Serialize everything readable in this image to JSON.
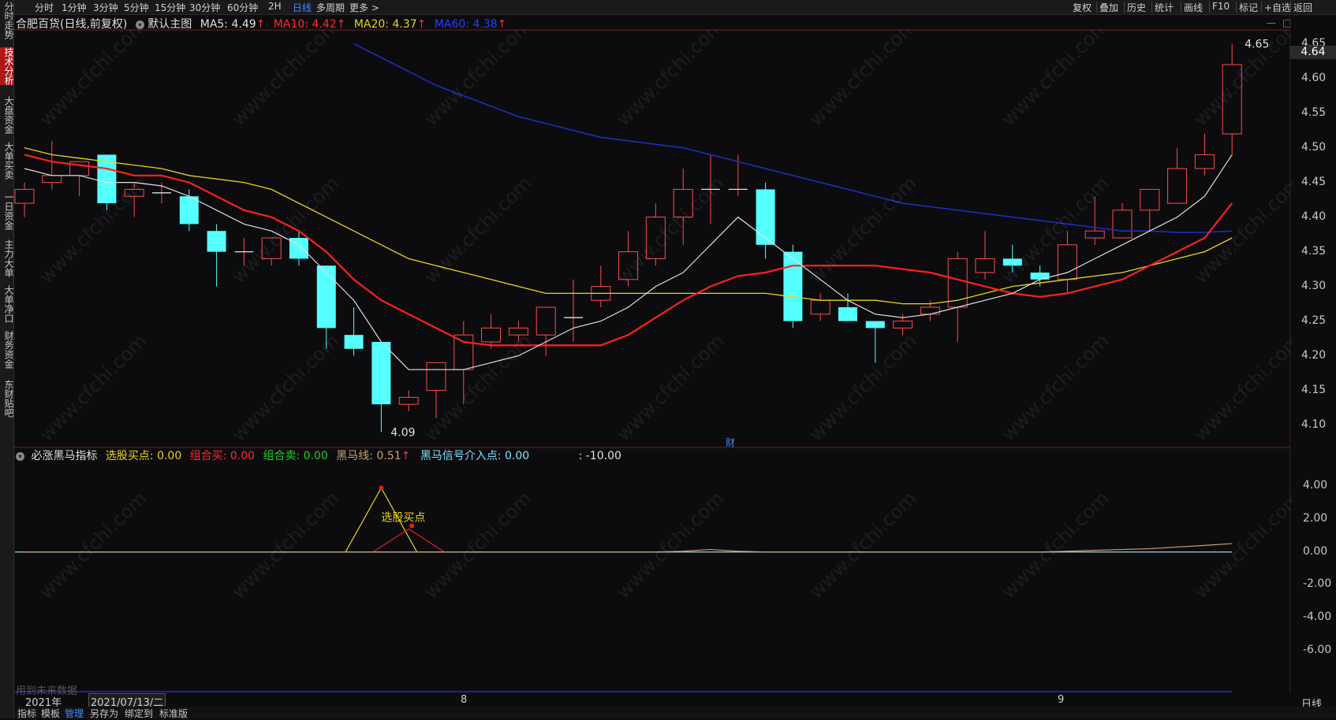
{
  "sidebar": {
    "items": [
      {
        "label": "分时走势",
        "active": false
      },
      {
        "label": "技术分析",
        "active": true
      },
      {
        "label": "大盘资金",
        "active": false
      },
      {
        "label": "大单买卖",
        "active": false
      },
      {
        "label": "一日资金",
        "active": false
      },
      {
        "label": "主力大单",
        "active": false
      },
      {
        "label": "大单净口",
        "active": false
      },
      {
        "label": "财务资金",
        "active": false
      },
      {
        "label": "东财贴吧",
        "active": false
      }
    ]
  },
  "toolbar": {
    "periods": [
      "分时",
      "1分钟",
      "3分钟",
      "5分钟",
      "15分钟",
      "30分钟",
      "60分钟",
      "2H",
      "日线",
      "多周期",
      "更多 >"
    ],
    "active_period": "日线",
    "right_items": [
      "复权",
      "叠加",
      "历史",
      "统计",
      "画线",
      "F10",
      "标记",
      "+自选",
      "返回"
    ]
  },
  "title": {
    "stock": "合肥百货(日线,前复权)",
    "template": "默认主图",
    "ma5": "MA5: 4.49",
    "ma10": "MA10: 4.42",
    "ma20": "MA20: 4.37",
    "ma60": "MA60: 4.38",
    "arrow": "↑"
  },
  "indicator": {
    "name": "必涨黑马指标",
    "buy": "选股买点: 0.00",
    "combo_buy": "组合买: 0.00",
    "combo_sell": "组合卖: 0.00",
    "horse_line": "黑马线: 0.51",
    "horse_signal": "黑马信号介入点: 0.00",
    "extra": ": -10.00",
    "annotation": "选股买点"
  },
  "window_controls": [
    "—",
    "□"
  ],
  "price_axis": [
    "4.65",
    "4.60",
    "4.55",
    "4.50",
    "4.45",
    "4.40",
    "4.35",
    "4.30",
    "4.25",
    "4.20",
    "4.15",
    "4.10"
  ],
  "last_price": "4.64",
  "ind_axis": [
    "4.00",
    "2.00",
    "0.00",
    "-2.00",
    "-4.00",
    "-6.00"
  ],
  "markers": {
    "high": "4.65",
    "low": "4.09",
    "finance": "财"
  },
  "future_note": "用到未来数据",
  "x_axis": {
    "year": "2021年",
    "cursor_date": "2021/07/13/二",
    "months": [
      "8",
      "9"
    ]
  },
  "timeframe_label": "日线",
  "bottom_tabs": [
    "指标",
    "模板",
    "管理",
    "另存为",
    "绑定到",
    "标准版"
  ],
  "bottom_active": "管理",
  "watermark": "www.cfchi.com",
  "colors": {
    "up": "#ff4c4c",
    "down": "#54ffff",
    "ma5": "#e0e0e0",
    "ma10": "#ff2020",
    "ma20": "#e6d322",
    "ma60": "#1d2fc8",
    "grid": "#7a1c1c"
  },
  "chart_data": {
    "type": "candlestick",
    "title": "合肥百货(日线,前复权)",
    "ylim": [
      4.07,
      4.67
    ],
    "candles": [
      {
        "o": 4.42,
        "h": 4.45,
        "l": 4.4,
        "c": 4.44
      },
      {
        "o": 4.45,
        "h": 4.51,
        "l": 4.44,
        "c": 4.46
      },
      {
        "o": 4.46,
        "h": 4.48,
        "l": 4.43,
        "c": 4.48
      },
      {
        "o": 4.49,
        "h": 4.49,
        "l": 4.41,
        "c": 4.42
      },
      {
        "o": 4.43,
        "h": 4.45,
        "l": 4.4,
        "c": 4.44
      },
      {
        "o": 4.435,
        "h": 4.45,
        "l": 4.42,
        "c": 4.435
      },
      {
        "o": 4.43,
        "h": 4.44,
        "l": 4.38,
        "c": 4.39
      },
      {
        "o": 4.38,
        "h": 4.39,
        "l": 4.3,
        "c": 4.35
      },
      {
        "o": 4.35,
        "h": 4.37,
        "l": 4.33,
        "c": 4.35
      },
      {
        "o": 4.34,
        "h": 4.37,
        "l": 4.33,
        "c": 4.37
      },
      {
        "o": 4.37,
        "h": 4.38,
        "l": 4.33,
        "c": 4.34
      },
      {
        "o": 4.33,
        "h": 4.33,
        "l": 4.21,
        "c": 4.24
      },
      {
        "o": 4.23,
        "h": 4.27,
        "l": 4.2,
        "c": 4.21
      },
      {
        "o": 4.22,
        "h": 4.22,
        "l": 4.09,
        "c": 4.13
      },
      {
        "o": 4.13,
        "h": 4.15,
        "l": 4.12,
        "c": 4.14
      },
      {
        "o": 4.15,
        "h": 4.19,
        "l": 4.11,
        "c": 4.19
      },
      {
        "o": 4.18,
        "h": 4.25,
        "l": 4.13,
        "c": 4.23
      },
      {
        "o": 4.22,
        "h": 4.26,
        "l": 4.21,
        "c": 4.24
      },
      {
        "o": 4.23,
        "h": 4.25,
        "l": 4.22,
        "c": 4.24
      },
      {
        "o": 4.23,
        "h": 4.24,
        "l": 4.2,
        "c": 4.27
      },
      {
        "o": 4.255,
        "h": 4.31,
        "l": 4.22,
        "c": 4.255
      },
      {
        "o": 4.28,
        "h": 4.33,
        "l": 4.27,
        "c": 4.3
      },
      {
        "o": 4.31,
        "h": 4.38,
        "l": 4.3,
        "c": 4.35
      },
      {
        "o": 4.34,
        "h": 4.42,
        "l": 4.33,
        "c": 4.4
      },
      {
        "o": 4.4,
        "h": 4.47,
        "l": 4.36,
        "c": 4.44
      },
      {
        "o": 4.44,
        "h": 4.49,
        "l": 4.39,
        "c": 4.44
      },
      {
        "o": 4.44,
        "h": 4.49,
        "l": 4.43,
        "c": 4.44
      },
      {
        "o": 4.44,
        "h": 4.45,
        "l": 4.34,
        "c": 4.36
      },
      {
        "o": 4.35,
        "h": 4.36,
        "l": 4.24,
        "c": 4.25
      },
      {
        "o": 4.26,
        "h": 4.29,
        "l": 4.25,
        "c": 4.28
      },
      {
        "o": 4.27,
        "h": 4.29,
        "l": 4.25,
        "c": 4.25
      },
      {
        "o": 4.25,
        "h": 4.25,
        "l": 4.19,
        "c": 4.24
      },
      {
        "o": 4.24,
        "h": 4.26,
        "l": 4.23,
        "c": 4.25
      },
      {
        "o": 4.26,
        "h": 4.28,
        "l": 4.25,
        "c": 4.27
      },
      {
        "o": 4.27,
        "h": 4.35,
        "l": 4.22,
        "c": 4.34
      },
      {
        "o": 4.32,
        "h": 4.38,
        "l": 4.31,
        "c": 4.34
      },
      {
        "o": 4.34,
        "h": 4.36,
        "l": 4.32,
        "c": 4.33
      },
      {
        "o": 4.32,
        "h": 4.33,
        "l": 4.3,
        "c": 4.31
      },
      {
        "o": 4.31,
        "h": 4.38,
        "l": 4.29,
        "c": 4.36
      },
      {
        "o": 4.37,
        "h": 4.43,
        "l": 4.36,
        "c": 4.38
      },
      {
        "o": 4.37,
        "h": 4.42,
        "l": 4.37,
        "c": 4.41
      },
      {
        "o": 4.41,
        "h": 4.44,
        "l": 4.38,
        "c": 4.44
      },
      {
        "o": 4.42,
        "h": 4.5,
        "l": 4.42,
        "c": 4.47
      },
      {
        "o": 4.47,
        "h": 4.52,
        "l": 4.46,
        "c": 4.49
      },
      {
        "o": 4.52,
        "h": 4.65,
        "l": 4.49,
        "c": 4.62
      }
    ],
    "ma5": [
      4.47,
      4.46,
      4.46,
      4.45,
      4.45,
      4.445,
      4.43,
      4.41,
      4.39,
      4.38,
      4.36,
      4.32,
      4.28,
      4.22,
      4.18,
      4.18,
      4.18,
      4.19,
      4.2,
      4.22,
      4.24,
      4.25,
      4.27,
      4.3,
      4.32,
      4.36,
      4.4,
      4.37,
      4.34,
      4.31,
      4.28,
      4.26,
      4.255,
      4.26,
      4.27,
      4.28,
      4.29,
      4.31,
      4.32,
      4.34,
      4.36,
      4.38,
      4.4,
      4.43,
      4.49
    ],
    "ma10": [
      4.49,
      4.48,
      4.475,
      4.47,
      4.46,
      4.46,
      4.45,
      4.43,
      4.41,
      4.4,
      4.38,
      4.35,
      4.31,
      4.28,
      4.26,
      4.24,
      4.22,
      4.215,
      4.215,
      4.215,
      4.215,
      4.215,
      4.23,
      4.255,
      4.28,
      4.3,
      4.315,
      4.32,
      4.33,
      4.33,
      4.33,
      4.33,
      4.325,
      4.32,
      4.31,
      4.3,
      4.29,
      4.285,
      4.29,
      4.3,
      4.31,
      4.33,
      4.35,
      4.37,
      4.42
    ],
    "ma20": [
      4.5,
      4.49,
      4.485,
      4.48,
      4.475,
      4.47,
      4.46,
      4.455,
      4.45,
      4.44,
      4.42,
      4.4,
      4.38,
      4.36,
      4.34,
      4.33,
      4.32,
      4.31,
      4.3,
      4.29,
      4.29,
      4.29,
      4.29,
      4.29,
      4.29,
      4.29,
      4.29,
      4.29,
      4.285,
      4.28,
      4.28,
      4.28,
      4.275,
      4.275,
      4.28,
      4.29,
      4.3,
      4.305,
      4.31,
      4.315,
      4.32,
      4.33,
      4.34,
      4.35,
      4.37
    ],
    "ma60": [
      null,
      null,
      null,
      null,
      null,
      null,
      null,
      null,
      null,
      null,
      null,
      null,
      4.65,
      4.63,
      4.61,
      4.59,
      4.575,
      4.56,
      4.545,
      4.535,
      4.525,
      4.515,
      4.51,
      4.505,
      4.5,
      4.49,
      4.48,
      4.47,
      4.46,
      4.45,
      4.44,
      4.43,
      4.42,
      4.415,
      4.41,
      4.405,
      4.4,
      4.395,
      4.39,
      4.385,
      4.38,
      4.38,
      4.378,
      4.378,
      4.38
    ],
    "indicator_ylim": [
      -8.5,
      5.5
    ],
    "indicator_signal": {
      "peak_index": 13,
      "peak_value": 3.9,
      "width": 1.3
    },
    "indicator_sub_signal": {
      "peak_index": 14,
      "peak_value": 1.4,
      "width": 1.3
    },
    "horse_line": [
      0,
      0,
      0,
      0,
      0,
      0,
      0,
      0,
      0,
      0,
      0,
      0,
      0,
      0,
      0,
      0,
      0,
      0,
      0,
      0,
      0,
      0,
      0,
      0,
      0.05,
      0.15,
      0.05,
      0,
      0,
      0,
      0,
      0,
      0,
      0,
      0,
      0,
      0,
      0,
      0.05,
      0.1,
      0.15,
      0.2,
      0.3,
      0.4,
      0.51
    ]
  }
}
